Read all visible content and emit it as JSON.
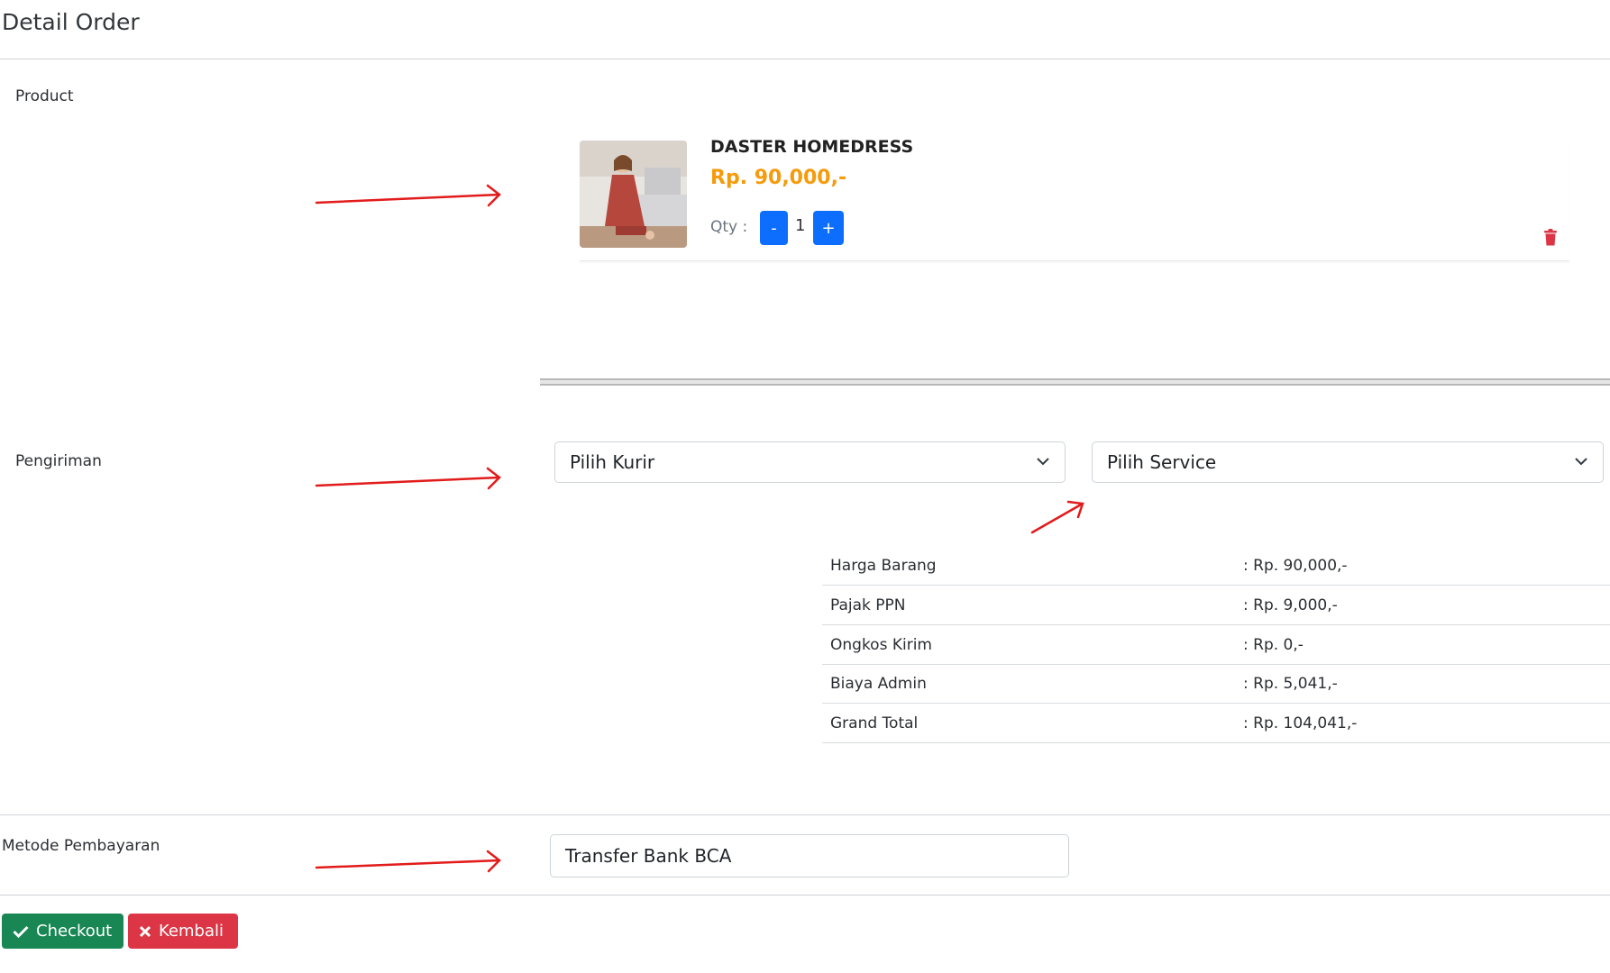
{
  "page": {
    "title": "Detail Order"
  },
  "labels": {
    "product": "Product",
    "shipping": "Pengiriman",
    "payment": "Metode Pembayaran"
  },
  "product": {
    "name": "DASTER HOMEDRESS",
    "price": "Rp. 90,000,-",
    "qty_label": "Qty :",
    "qty_value": "1",
    "minus_label": "-",
    "plus_label": "+",
    "thumbnail_icon": "product-photo",
    "delete_icon": "trash-icon"
  },
  "shipping": {
    "courier_select": "Pilih Kurir",
    "service_select": "Pilih Service"
  },
  "summary": [
    {
      "label": "Harga Barang",
      "value": ": Rp. 90,000,-"
    },
    {
      "label": "Pajak PPN",
      "value": ": Rp. 9,000,-"
    },
    {
      "label": "Ongkos Kirim",
      "value": ": Rp. 0,-"
    },
    {
      "label": "Biaya Admin",
      "value": ": Rp. 5,041,-"
    },
    {
      "label": "Grand Total",
      "value": ": Rp. 104,041,-"
    }
  ],
  "payment": {
    "method": "Transfer Bank BCA"
  },
  "actions": {
    "checkout_label": "Checkout",
    "back_label": "Kembali"
  },
  "colors": {
    "primary": "#0d6efd",
    "success": "#198754",
    "danger": "#dc3545",
    "price": "#f59b0c",
    "annotation_arrow": "#e21b1b"
  }
}
